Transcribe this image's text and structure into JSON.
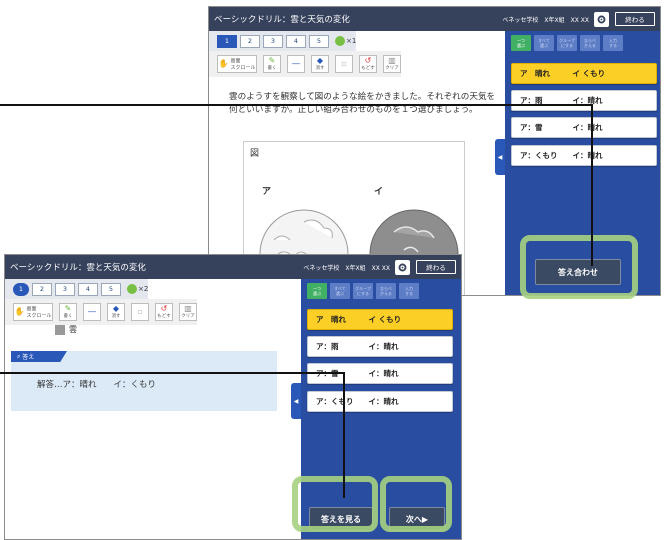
{
  "back_window": {
    "title": "ベーシックドリル：雲と天気の変化",
    "school": "ベネッセ学校　X年X組　XX XX",
    "end_button": "終わる",
    "page_tabs": [
      "1",
      "2",
      "3",
      "4",
      "5"
    ],
    "bonus": "×1",
    "tools": {
      "scroll": "画面\nスクロール",
      "pen": "書く",
      "line": "",
      "eraser": "消す",
      "undo": "もどす",
      "clear": "クリア"
    },
    "question": "雲のようすを観察して図のような絵をかきました。それぞれの天気を何といいますか。正しい組み合わせのものを１つ選びましょう。",
    "figure_title": "図",
    "figure_labels": [
      "ア",
      "イ"
    ],
    "mode_tabs": [
      "一つ\n選ぶ",
      "すべて\n選ぶ",
      "グループ\nにする",
      "ならべ\nかえる",
      "入力\nする"
    ],
    "choices": [
      "ア　晴れ　　　イ くもり",
      "ア：雨　　　　イ：晴れ",
      "ア：雪　　　　イ：晴れ",
      "ア：くもり　　イ：晴れ"
    ],
    "check_button": "答え合わせ"
  },
  "front_window": {
    "title": "ベーシックドリル：雲と天気の変化",
    "school": "ベネッセ学校　X年X組　XX XX",
    "end_button": "終わる",
    "page_tabs": [
      "1",
      "2",
      "3",
      "4",
      "5"
    ],
    "bonus": "×2",
    "figure_label": "雲",
    "answer_label": "答え",
    "answer_text": "解答…ア：晴れ　　イ：くもり",
    "mode_tabs": [
      "一つ\n選ぶ",
      "すべて\n選ぶ",
      "グループ\nにする",
      "ならべ\nかえる",
      "入力\nする"
    ],
    "choices": [
      "ア　晴れ　　　イ くもり",
      "ア：雨　　　　イ：晴れ",
      "ア：雪　　　　イ：晴れ",
      "ア：くもり　　イ：晴れ"
    ],
    "show_answer_button": "答えを見る",
    "next_button": "次へ▶"
  },
  "colors": {
    "titlebar": "#36415c",
    "panel": "#294da0",
    "selected": "#fbcf26",
    "highlight": "#a6d27f"
  }
}
